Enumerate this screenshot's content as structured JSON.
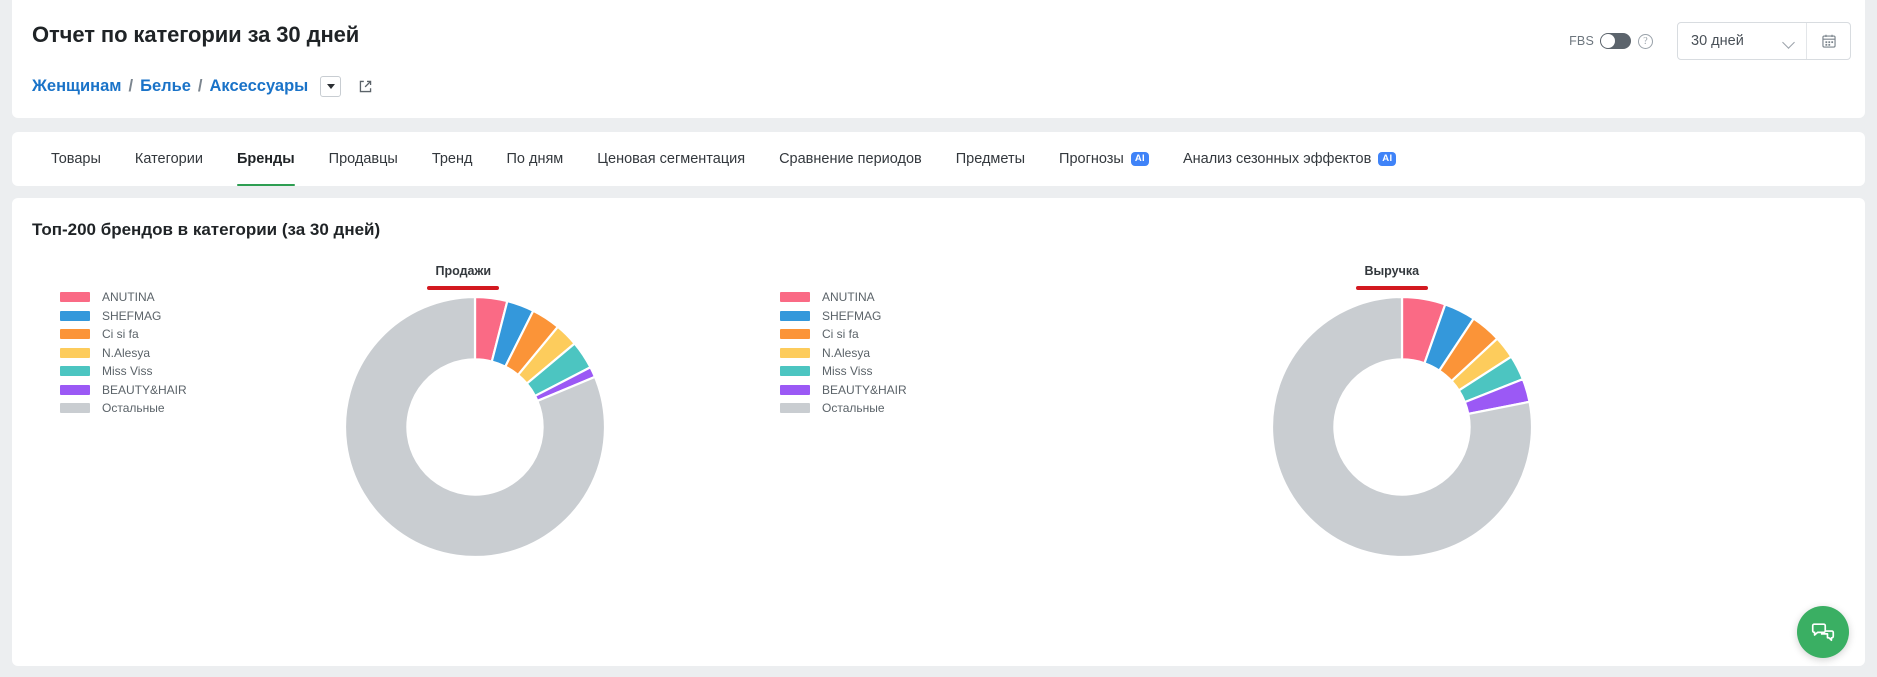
{
  "header": {
    "title": "Отчет по категории за 30 дней",
    "breadcrumb": [
      "Женщинам",
      "Белье",
      "Аксессуары"
    ],
    "breadcrumb_separator": "/",
    "dropdown_icon": "caret-down-icon",
    "external_link_icon": "external-link-icon",
    "fbs_label": "FBS",
    "fbs_enabled": false,
    "help_icon": "question-mark-icon",
    "date_range": "30 дней",
    "calendar_icon": "calendar-icon",
    "chevron_icon": "chevron-down-icon"
  },
  "tabs": [
    {
      "label": "Товары",
      "active": false,
      "ai": false
    },
    {
      "label": "Категории",
      "active": false,
      "ai": false
    },
    {
      "label": "Бренды",
      "active": true,
      "ai": false
    },
    {
      "label": "Продавцы",
      "active": false,
      "ai": false
    },
    {
      "label": "Тренд",
      "active": false,
      "ai": false
    },
    {
      "label": "По дням",
      "active": false,
      "ai": false
    },
    {
      "label": "Ценовая сегментация",
      "active": false,
      "ai": false
    },
    {
      "label": "Сравнение периодов",
      "active": false,
      "ai": false
    },
    {
      "label": "Предметы",
      "active": false,
      "ai": false
    },
    {
      "label": "Прогнозы",
      "active": false,
      "ai": true
    },
    {
      "label": "Анализ сезонных эффектов",
      "active": false,
      "ai": true
    }
  ],
  "ai_badge_text": "AI",
  "main": {
    "section_title": "Топ-200 брендов в категории (за 30 дней)"
  },
  "colors": {
    "accent_green": "#2e9e52",
    "link_blue": "#1a73c8",
    "ai_blue": "#3f83f8",
    "title_underline_red": "#d31920",
    "chat_green": "#3aaf63"
  },
  "chat_widget": {
    "icon": "chat-bubbles-icon"
  },
  "chart_data": [
    {
      "type": "pie",
      "variant": "donut",
      "title": "Продажи",
      "labels": [
        "ANUTINA",
        "SHEFMAG",
        "Ci si fa",
        "N.Alesya",
        "Miss Viss",
        "BEAUTY&HAIR",
        "Остальные"
      ],
      "values": [
        4.0,
        3.4,
        3.6,
        2.9,
        3.5,
        1.3,
        81.3
      ],
      "colors": [
        "#fa6a85",
        "#3498db",
        "#fb9438",
        "#fdcc5c",
        "#4cc5c1",
        "#9b59f5",
        "#c9cdd1"
      ],
      "legend_position": "left",
      "start_angle": 0,
      "inner_radius_ratio": 0.52
    },
    {
      "type": "pie",
      "variant": "donut",
      "title": "Выручка",
      "labels": [
        "ANUTINA",
        "SHEFMAG",
        "Ci si fa",
        "N.Alesya",
        "Miss Viss",
        "BEAUTY&HAIR",
        "Остальные"
      ],
      "values": [
        5.4,
        3.9,
        3.8,
        2.8,
        3.1,
        2.9,
        78.1
      ],
      "colors": [
        "#fa6a85",
        "#3498db",
        "#fb9438",
        "#fdcc5c",
        "#4cc5c1",
        "#9b59f5",
        "#c9cdd1"
      ],
      "legend_position": "left",
      "start_angle": 0,
      "inner_radius_ratio": 0.52
    }
  ]
}
